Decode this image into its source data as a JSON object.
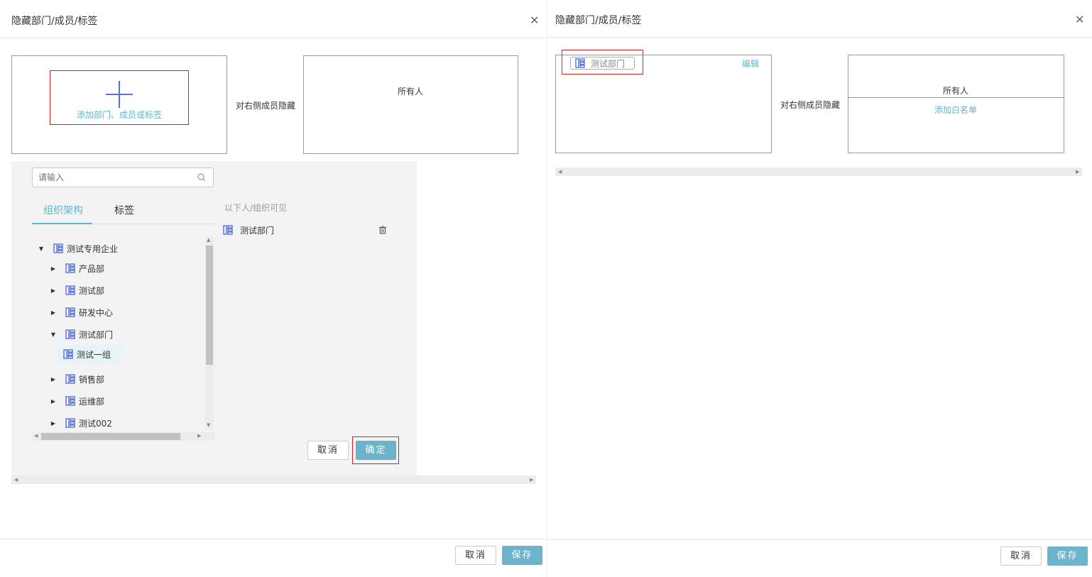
{
  "left_dialog": {
    "title": "隐藏部门/成员/标签",
    "add_label": "添加部门、成员或标签",
    "hide_label": "对右侧成员隐藏",
    "everyone_label": "所有人",
    "picker": {
      "search_placeholder": "请输入",
      "tabs": [
        {
          "label": "组织架构",
          "active": true
        },
        {
          "label": "标签",
          "active": false
        }
      ],
      "visible_heading": "以下人/组织可见",
      "selected_item": "测试部门",
      "tree": [
        {
          "label": "测试专用企业",
          "caret": "down"
        },
        {
          "label": "产品部",
          "caret": "right"
        },
        {
          "label": "测试部",
          "caret": "right"
        },
        {
          "label": "研发中心",
          "caret": "right"
        },
        {
          "label": "测试部门",
          "caret": "down"
        },
        {
          "label": "测试一组",
          "caret": "none"
        },
        {
          "label": "销售部",
          "caret": "right"
        },
        {
          "label": "运维部",
          "caret": "right"
        },
        {
          "label": "测试002",
          "caret": "right"
        }
      ],
      "cancel_label": "取消",
      "confirm_label": "确定"
    },
    "footer_cancel": "取消",
    "footer_save": "保存"
  },
  "right_dialog": {
    "title": "隐藏部门/成员/标签",
    "tag_label": "测试部门",
    "edit_label": "编辑",
    "hide_label": "对右侧成员隐藏",
    "everyone_label": "所有人",
    "whitelist_label": "添加白名单",
    "footer_cancel": "取消",
    "footer_save": "保存"
  },
  "colors": {
    "accent": "#5bb8d0",
    "primary_button": "#6bb4cc",
    "highlight_red": "#e02020",
    "plus": "#5a6fd6"
  },
  "icons": [
    "close-icon",
    "plus-icon",
    "search-icon",
    "org-icon",
    "trash-icon",
    "caret-down-icon",
    "caret-right-icon"
  ]
}
